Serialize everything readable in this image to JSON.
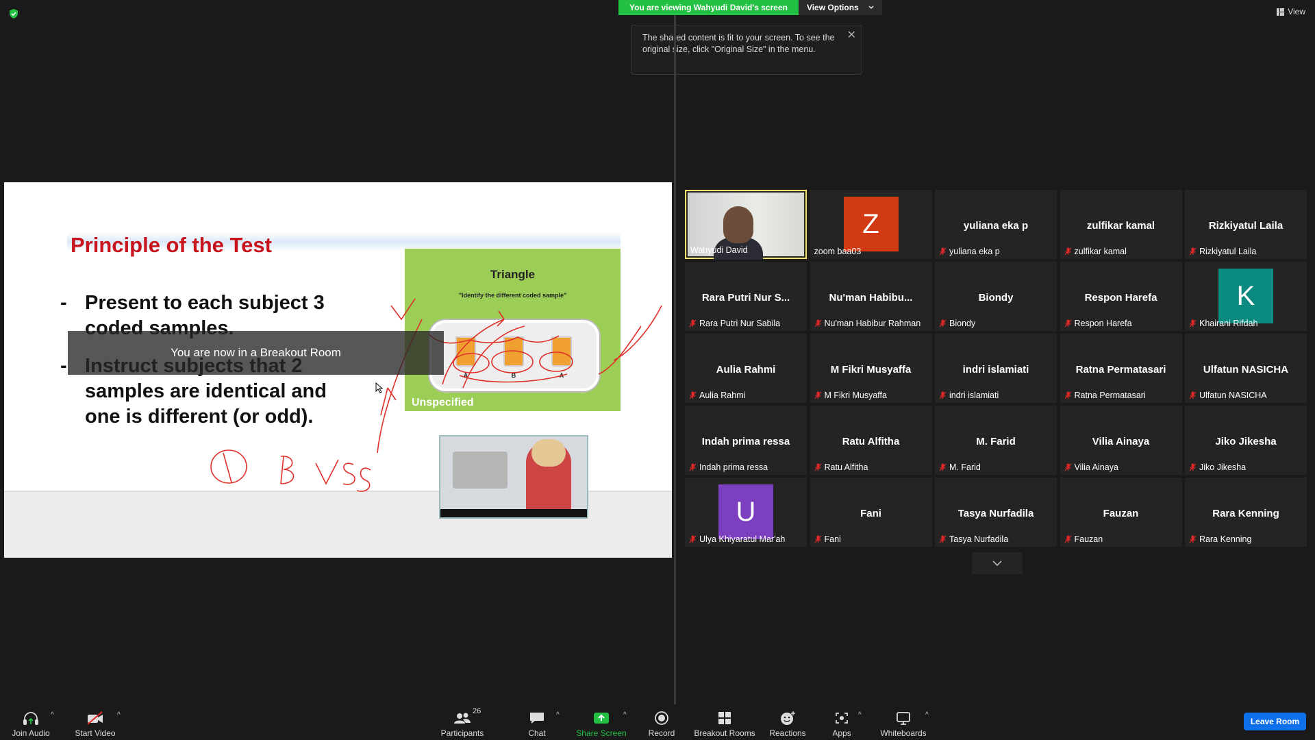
{
  "banner": {
    "viewing": "You are viewing Wahyudi David's screen",
    "options": "View Options"
  },
  "top_right": {
    "view": "View"
  },
  "tooltip": {
    "text": "The shared content is fit to your screen. To see the original size, click \"Original Size\" in the menu."
  },
  "slide": {
    "title": "Principle of the Test",
    "bullet1_dash": "-",
    "bullet1_line1": "Present to each subject 3",
    "bullet1_line2": "coded samples.",
    "bullet2_dash": "-",
    "bullet2_line1": "Instruct subjects that 2",
    "bullet2_line2": "samples are identical and",
    "bullet2_line3": "one is different (or odd).",
    "box_title": "Triangle",
    "box_sub": "\"Identify the different coded sample\"",
    "box_footer": "Unspecified",
    "cups": [
      {
        "code": "458",
        "letter": "A"
      },
      {
        "code": "207",
        "letter": "B"
      },
      {
        "code": "962",
        "letter": "A"
      }
    ]
  },
  "breakout_notice": "You are now in a Breakout Room",
  "participants": [
    {
      "display": "",
      "label": "Wahyudi David",
      "video": true,
      "active": true,
      "muted": false
    },
    {
      "display": "",
      "label": "zoom baa03",
      "avatar": "Z",
      "avatar_color": "#d23a13",
      "muted": false
    },
    {
      "display": "yuliana eka p",
      "label": "yuliana eka p",
      "muted": true
    },
    {
      "display": "zulfikar kamal",
      "label": "zulfikar kamal",
      "muted": true
    },
    {
      "display": "Rizkiyatul Laila",
      "label": "Rizkiyatul Laila",
      "muted": true
    },
    {
      "display": "Rara Putri Nur S...",
      "label": "Rara Putri Nur Sabila",
      "muted": true
    },
    {
      "display": "Nu'man  Habibu...",
      "label": "Nu'man Habibur Rahman",
      "muted": true
    },
    {
      "display": "Biondy",
      "label": "Biondy",
      "muted": true
    },
    {
      "display": "Respon Harefa",
      "label": "Respon Harefa",
      "muted": true
    },
    {
      "display": "",
      "label": "Khairani Rifdah",
      "avatar": "K",
      "avatar_color": "#0b8a80",
      "muted": true
    },
    {
      "display": "Aulia Rahmi",
      "label": "Aulia Rahmi",
      "muted": true
    },
    {
      "display": "M Fikri Musyaffa",
      "label": "M Fikri Musyaffa",
      "muted": true
    },
    {
      "display": "indri islamiati",
      "label": "indri islamiati",
      "muted": true
    },
    {
      "display": "Ratna Permatasari",
      "label": "Ratna Permatasari",
      "muted": true
    },
    {
      "display": "Ulfatun NASICHA",
      "label": "Ulfatun NASICHA",
      "muted": true
    },
    {
      "display": "Indah prima ressa",
      "label": "Indah prima ressa",
      "muted": true
    },
    {
      "display": "Ratu Alfitha",
      "label": "Ratu Alfitha",
      "muted": true
    },
    {
      "display": "M. Farid",
      "label": "M. Farid",
      "muted": true
    },
    {
      "display": "Vilia Ainaya",
      "label": "Vilia Ainaya",
      "muted": true
    },
    {
      "display": "Jiko Jikesha",
      "label": "Jiko Jikesha",
      "muted": true
    },
    {
      "display": "",
      "label": "Ulya Khiyaratul Mar'ah",
      "avatar": "U",
      "avatar_color": "#7c3fbf",
      "muted": true
    },
    {
      "display": "Fani",
      "label": "Fani",
      "muted": true
    },
    {
      "display": "Tasya Nurfadila",
      "label": "Tasya Nurfadila",
      "muted": true
    },
    {
      "display": "Fauzan",
      "label": "Fauzan",
      "muted": true
    },
    {
      "display": "Rara Kenning",
      "label": "Rara Kenning",
      "muted": true
    }
  ],
  "toolbar": {
    "join_audio": "Join Audio",
    "start_video": "Start Video",
    "participants": "Participants",
    "participants_count": "26",
    "chat": "Chat",
    "share_screen": "Share Screen",
    "record": "Record",
    "breakout_rooms": "Breakout Rooms",
    "reactions": "Reactions",
    "apps": "Apps",
    "whiteboards": "Whiteboards",
    "leave": "Leave Room"
  },
  "colors": {
    "share_green": "#23c043",
    "leave_blue": "#0e71eb",
    "active_border": "#f6e36a",
    "mute_red": "#e02828"
  }
}
